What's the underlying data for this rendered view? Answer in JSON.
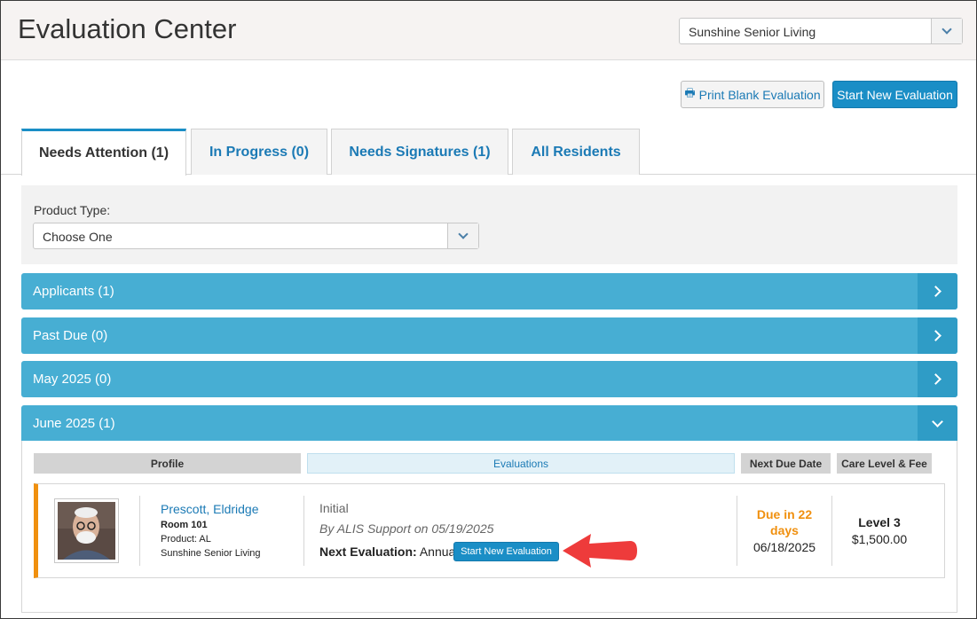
{
  "header": {
    "title": "Evaluation Center",
    "community_select": {
      "value": "Sunshine Senior Living"
    }
  },
  "toolbar": {
    "print_label": "Print Blank Evaluation",
    "start_label": "Start New Evaluation"
  },
  "tabs": [
    {
      "label": "Needs Attention (1)",
      "active": true
    },
    {
      "label": "In Progress (0)",
      "active": false
    },
    {
      "label": "Needs Signatures (1)",
      "active": false
    },
    {
      "label": "All Residents",
      "active": false
    }
  ],
  "filter": {
    "label": "Product Type:",
    "value": "Choose One"
  },
  "groups": [
    {
      "label": "Applicants (1)",
      "expanded": false
    },
    {
      "label": "Past Due (0)",
      "expanded": false
    },
    {
      "label": "May 2025 (0)",
      "expanded": false
    },
    {
      "label": "June 2025 (1)",
      "expanded": true
    }
  ],
  "columns": {
    "profile": "Profile",
    "evaluations": "Evaluations",
    "next_due": "Next Due Date",
    "care": "Care Level & Fee"
  },
  "resident": {
    "name": "Prescott, Eldridge",
    "room": "Room 101",
    "product": "Product: AL",
    "community": "Sunshine Senior Living",
    "eval_type": "Initial",
    "eval_by": "By ALIS Support on 05/19/2025",
    "next_eval_label": "Next Evaluation:",
    "next_eval_value": "Annual",
    "start_button": "Start New Evaluation",
    "due_in": "Due in 22 days",
    "due_date": "06/18/2025",
    "care_level": "Level 3",
    "care_fee": "$1,500.00"
  },
  "colors": {
    "accent": "#1a8ec6",
    "group_bar": "#47aed3",
    "due_warning": "#f0900f",
    "annotation_arrow": "#ee3b3b"
  }
}
